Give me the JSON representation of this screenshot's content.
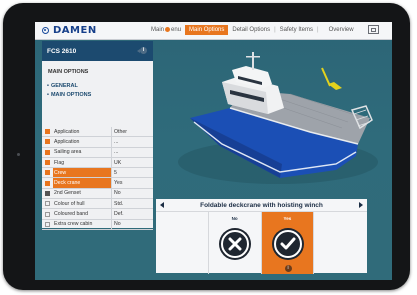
{
  "app": {
    "logo_text": "DAMEN"
  },
  "nav": {
    "items": [
      {
        "label": "Main",
        "label2": "enu",
        "active": false
      },
      {
        "label": "Main Options",
        "active": true
      },
      {
        "label": "Detail Options",
        "active": false
      },
      {
        "label": "Safety Items",
        "active": false
      },
      {
        "label": "Overview",
        "active": false
      }
    ],
    "separator": "|"
  },
  "sidepanel": {
    "title": "FCS 2610",
    "section_title": "MAIN OPTIONS",
    "links": [
      "GENERAL",
      "MAIN OPTIONS"
    ],
    "rows": [
      {
        "label": "Application",
        "value": "Other",
        "state": "on",
        "highlight": false
      },
      {
        "label": "Application",
        "value": "...",
        "state": "on",
        "highlight": false
      },
      {
        "label": "Sailing area",
        "value": "...",
        "state": "on",
        "highlight": false
      },
      {
        "label": "Flag",
        "value": "UK",
        "state": "on",
        "highlight": false
      },
      {
        "label": "Crew",
        "value": "5",
        "state": "on",
        "highlight": true
      },
      {
        "label": "Deck crane",
        "value": "Yes",
        "state": "on",
        "highlight": true
      },
      {
        "label": "2nd Genset",
        "value": "No",
        "state": "dark",
        "highlight": false
      },
      {
        "label": "Colour of hull",
        "value": "Std.",
        "state": "off",
        "highlight": false
      },
      {
        "label": "Coloured band",
        "value": "Def.",
        "state": "off",
        "highlight": false
      },
      {
        "label": "Extra crew cabin",
        "value": "No",
        "state": "off",
        "highlight": false
      }
    ]
  },
  "bottom_panel": {
    "title": "Foldable deckcrane with hoisting winch",
    "options": [
      {
        "label": "",
        "type": "empty"
      },
      {
        "label": "No",
        "type": "no"
      },
      {
        "label": "Yes",
        "type": "yes"
      },
      {
        "label": "",
        "type": "empty"
      }
    ]
  },
  "colors": {
    "accent": "#e8761f",
    "navy": "#1c4a6f",
    "sea": "#2f6b7b"
  }
}
